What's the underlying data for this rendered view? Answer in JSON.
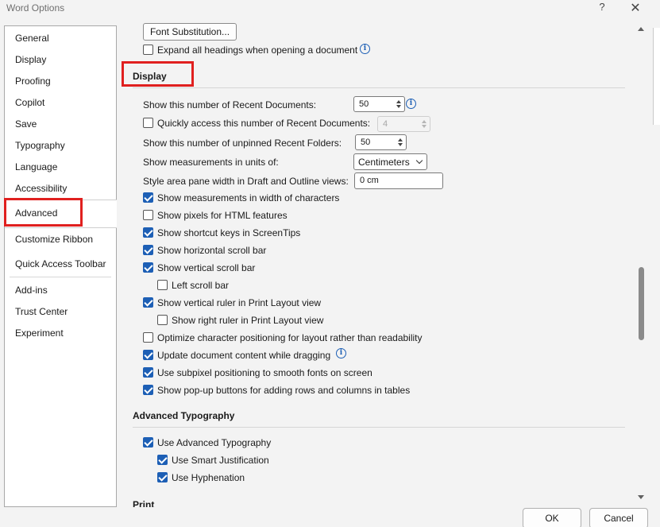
{
  "window": {
    "title": "Word Options",
    "help_label": "?",
    "close_label": "✕"
  },
  "nav": {
    "items": [
      "General",
      "Display",
      "Proofing",
      "Copilot",
      "Save",
      "Typography",
      "Language",
      "Accessibility",
      "Advanced",
      "Customize Ribbon",
      "Quick Access Toolbar",
      "Add-ins",
      "Trust Center",
      "Experiment"
    ],
    "selected": "Advanced"
  },
  "top": {
    "font_substitution_label": "Font Substitution...",
    "expand_headings_label": "Expand all headings when opening a document",
    "expand_headings_checked": false
  },
  "display_section": {
    "heading": "Display",
    "recent_docs_label": "Show this number of Recent Documents:",
    "recent_docs_value": "50",
    "quick_access_label": "Quickly access this number of Recent Documents:",
    "quick_access_checked": false,
    "quick_access_value": "4",
    "unpinned_folders_label": "Show this number of unpinned Recent Folders:",
    "unpinned_folders_value": "50",
    "measurements_label": "Show measurements in units of:",
    "measurements_value": "Centimeters",
    "style_area_label": "Style area pane width in Draft and Outline views:",
    "style_area_value": "0 cm",
    "checkboxes": [
      {
        "label": "Show measurements in width of characters",
        "checked": true
      },
      {
        "label": "Show pixels for HTML features",
        "checked": false
      },
      {
        "label": "Show shortcut keys in ScreenTips",
        "checked": true
      },
      {
        "label": "Show horizontal scroll bar",
        "checked": true
      },
      {
        "label": "Show vertical scroll bar",
        "checked": true
      },
      {
        "label": "Left scroll bar",
        "checked": false
      },
      {
        "label": "Show vertical ruler in Print Layout view",
        "checked": true
      },
      {
        "label": "Show right ruler in Print Layout view",
        "checked": false
      },
      {
        "label": "Optimize character positioning for layout rather than readability",
        "checked": false
      },
      {
        "label": "Update document content while dragging",
        "checked": true
      },
      {
        "label": "Use subpixel positioning to smooth fonts on screen",
        "checked": true
      },
      {
        "label": "Show pop-up buttons for adding rows and columns in tables",
        "checked": true
      }
    ]
  },
  "typography_section": {
    "heading": "Advanced Typography",
    "checkboxes": [
      {
        "label": "Use Advanced Typography",
        "checked": true
      },
      {
        "label": "Use Smart Justification",
        "checked": true
      },
      {
        "label": "Use Hyphenation",
        "checked": true
      }
    ]
  },
  "next_section_heading": "Print",
  "footer": {
    "ok_label": "OK",
    "cancel_label": "Cancel"
  },
  "highlight_color": "#e0201f",
  "accent_color": "#1d5fb5"
}
